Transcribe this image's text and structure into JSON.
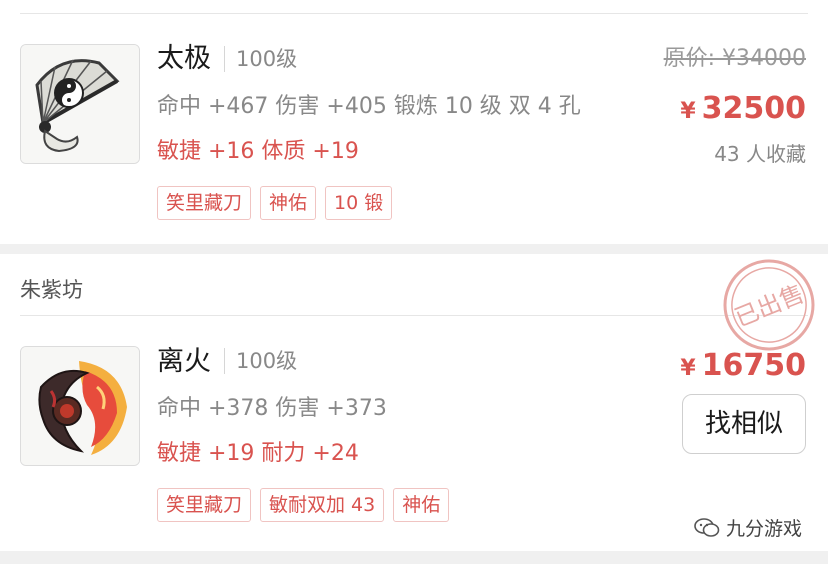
{
  "items": [
    {
      "name": "太极",
      "level": "100级",
      "stats": "命中 +467 伤害 +405 锻炼 10 级 双 4 孔",
      "bonus": "敏捷 +16 体质 +19",
      "tags": [
        "笑里藏刀",
        "神佑",
        "10 锻"
      ],
      "original_price": "原价: ¥34000",
      "currency": "¥",
      "price": "32500",
      "favorites": "43 人收藏",
      "icon": "fan-weapon-icon"
    },
    {
      "name": "离火",
      "level": "100级",
      "stats": "命中 +378 伤害 +373",
      "bonus": "敏捷 +19 耐力 +24",
      "tags": [
        "笑里藏刀",
        "敏耐双加 43",
        "神佑"
      ],
      "currency": "¥",
      "price": "16750",
      "similar_label": "找相似",
      "sold_stamp": "已出售",
      "icon": "fire-blade-icon"
    }
  ],
  "shop": {
    "name": "朱紫坊"
  },
  "watermark": {
    "text": "九分游戏",
    "icon": "wechat-icon"
  },
  "colors": {
    "accent": "#d9534f",
    "muted": "#888888",
    "tag_border": "#f0c4c2"
  }
}
